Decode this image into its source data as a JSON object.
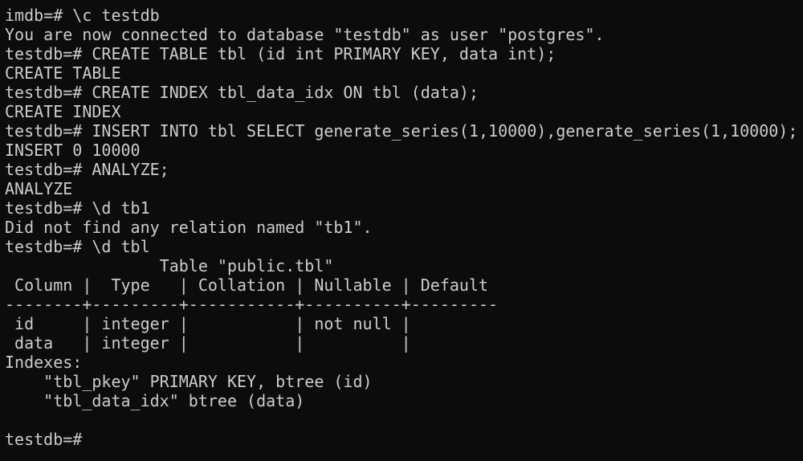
{
  "terminal": {
    "colors": {
      "background": "#0c0c0c",
      "foreground": "#cccccc"
    },
    "lines": [
      "imdb=# \\c testdb",
      "You are now connected to database \"testdb\" as user \"postgres\".",
      "testdb=# CREATE TABLE tbl (id int PRIMARY KEY, data int);",
      "CREATE TABLE",
      "testdb=# CREATE INDEX tbl_data_idx ON tbl (data);",
      "CREATE INDEX",
      "testdb=# INSERT INTO tbl SELECT generate_series(1,10000),generate_series(1,10000);",
      "INSERT 0 10000",
      "testdb=# ANALYZE;",
      "ANALYZE",
      "testdb=# \\d tb1",
      "Did not find any relation named \"tb1\".",
      "testdb=# \\d tbl",
      "                Table \"public.tbl\"",
      " Column |  Type   | Collation | Nullable | Default",
      "--------+---------+-----------+----------+---------",
      " id     | integer |           | not null |",
      " data   | integer |           |          |",
      "Indexes:",
      "    \"tbl_pkey\" PRIMARY KEY, btree (id)",
      "    \"tbl_data_idx\" btree (data)",
      "",
      "testdb=#"
    ]
  }
}
